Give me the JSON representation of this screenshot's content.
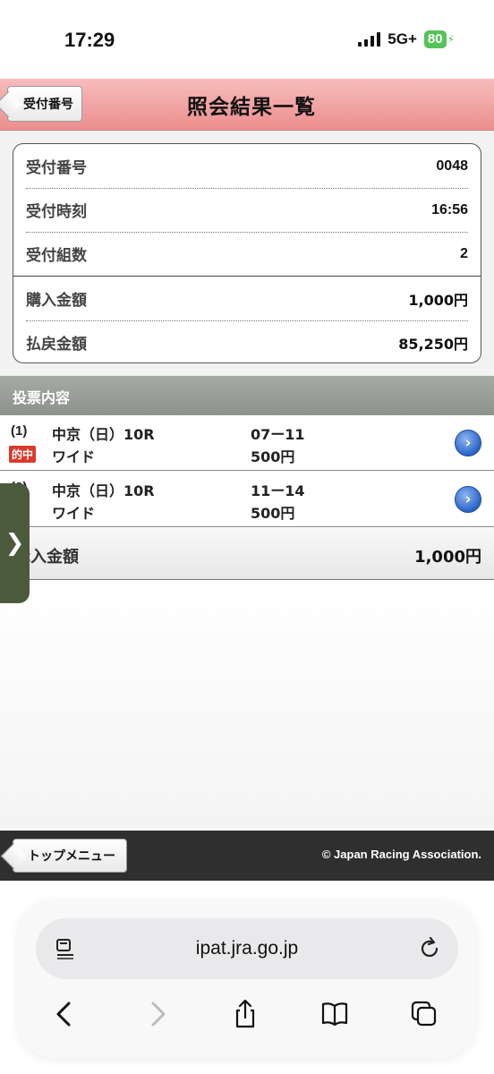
{
  "status_bar": {
    "time": "17:29",
    "network": "5G+",
    "battery": "80"
  },
  "header": {
    "back_label": "受付番号",
    "title": "照会結果一覧"
  },
  "summary": [
    {
      "label": "受付番号",
      "value": "0048"
    },
    {
      "label": "受付時刻",
      "value": "16:56"
    },
    {
      "label": "受付組数",
      "value": "2"
    },
    {
      "label": "購入金額",
      "value": "1,000円"
    },
    {
      "label": "払戻金額",
      "value": "85,250円"
    }
  ],
  "section": {
    "title": "投票内容"
  },
  "bets": [
    {
      "num": "(1)",
      "race": "中京（日）10R",
      "type": "ワイド",
      "combo": "07ー11",
      "amount": "500円",
      "badge": "的中"
    },
    {
      "num": "(2)",
      "race": "中京（日）10R",
      "type": "ワイド",
      "combo": "11ー14",
      "amount": "500円",
      "badge": ""
    }
  ],
  "total": {
    "label": "購入金額",
    "value": "1,000円"
  },
  "side_tab": {
    "glyph": "❯"
  },
  "footer": {
    "top_menu_label": "トップメニュー",
    "copyright": "© Japan Racing Association."
  },
  "browser": {
    "url": "ipat.jra.go.jp"
  }
}
